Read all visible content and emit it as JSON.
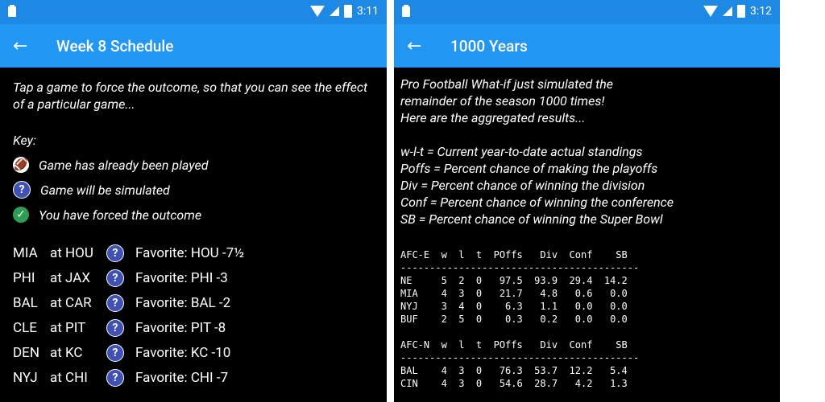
{
  "left": {
    "status_time": "3:11",
    "title": "Week 8 Schedule",
    "intro": "Tap a game to force the outcome, so that you can see the  effect of a particular game...",
    "key_label": "Key:",
    "key_items": [
      {
        "icon": "football-icon",
        "text": "Game has already been played"
      },
      {
        "icon": "question-icon",
        "text": "Game will be simulated"
      },
      {
        "icon": "check-icon",
        "text": "You have forced the outcome"
      }
    ],
    "games": [
      {
        "away": "MIA",
        "home": "at HOU",
        "fav": "Favorite: HOU -7½"
      },
      {
        "away": "PHI",
        "home": "at JAX",
        "fav": "Favorite: PHI -3"
      },
      {
        "away": "BAL",
        "home": "at CAR",
        "fav": "Favorite: BAL -2"
      },
      {
        "away": "CLE",
        "home": "at PIT",
        "fav": "Favorite: PIT -8"
      },
      {
        "away": "DEN",
        "home": "at KC",
        "fav": "Favorite: KC -10"
      },
      {
        "away": "NYJ",
        "home": "at CHI",
        "fav": "Favorite: CHI -7"
      }
    ]
  },
  "right": {
    "status_time": "3:12",
    "title": "1000 Years",
    "intro_lines": [
      "Pro Football What-if just simulated the",
      "remainder of the season 1000 times!",
      "Here are the aggregated results..."
    ],
    "legend_lines": [
      "w-l-t = Current year-to-date actual standings",
      "Poffs = Percent chance of making the playoffs",
      "Div = Percent chance of winning the division",
      "Conf = Percent chance of winning the conference",
      "SB = Percent chance of winning the Super Bowl"
    ],
    "table_text": "AFC-E  w  l  t  POffs   Div  Conf    SB\n-----------------------------------------\nNE     5  2  0   97.5  93.9  29.4  14.2\nMIA    4  3  0   21.7   4.8   0.6   0.0\nNYJ    3  4  0    6.3   1.1   0.0   0.0\nBUF    2  5  0    0.3   0.2   0.0   0.0\n\nAFC-N  w  l  t  POffs   Div  Conf    SB\n-----------------------------------------\nBAL    4  3  0   76.3  53.7  12.2   5.4\nCIN    4  3  0   54.6  28.7   4.2   1.3"
  }
}
